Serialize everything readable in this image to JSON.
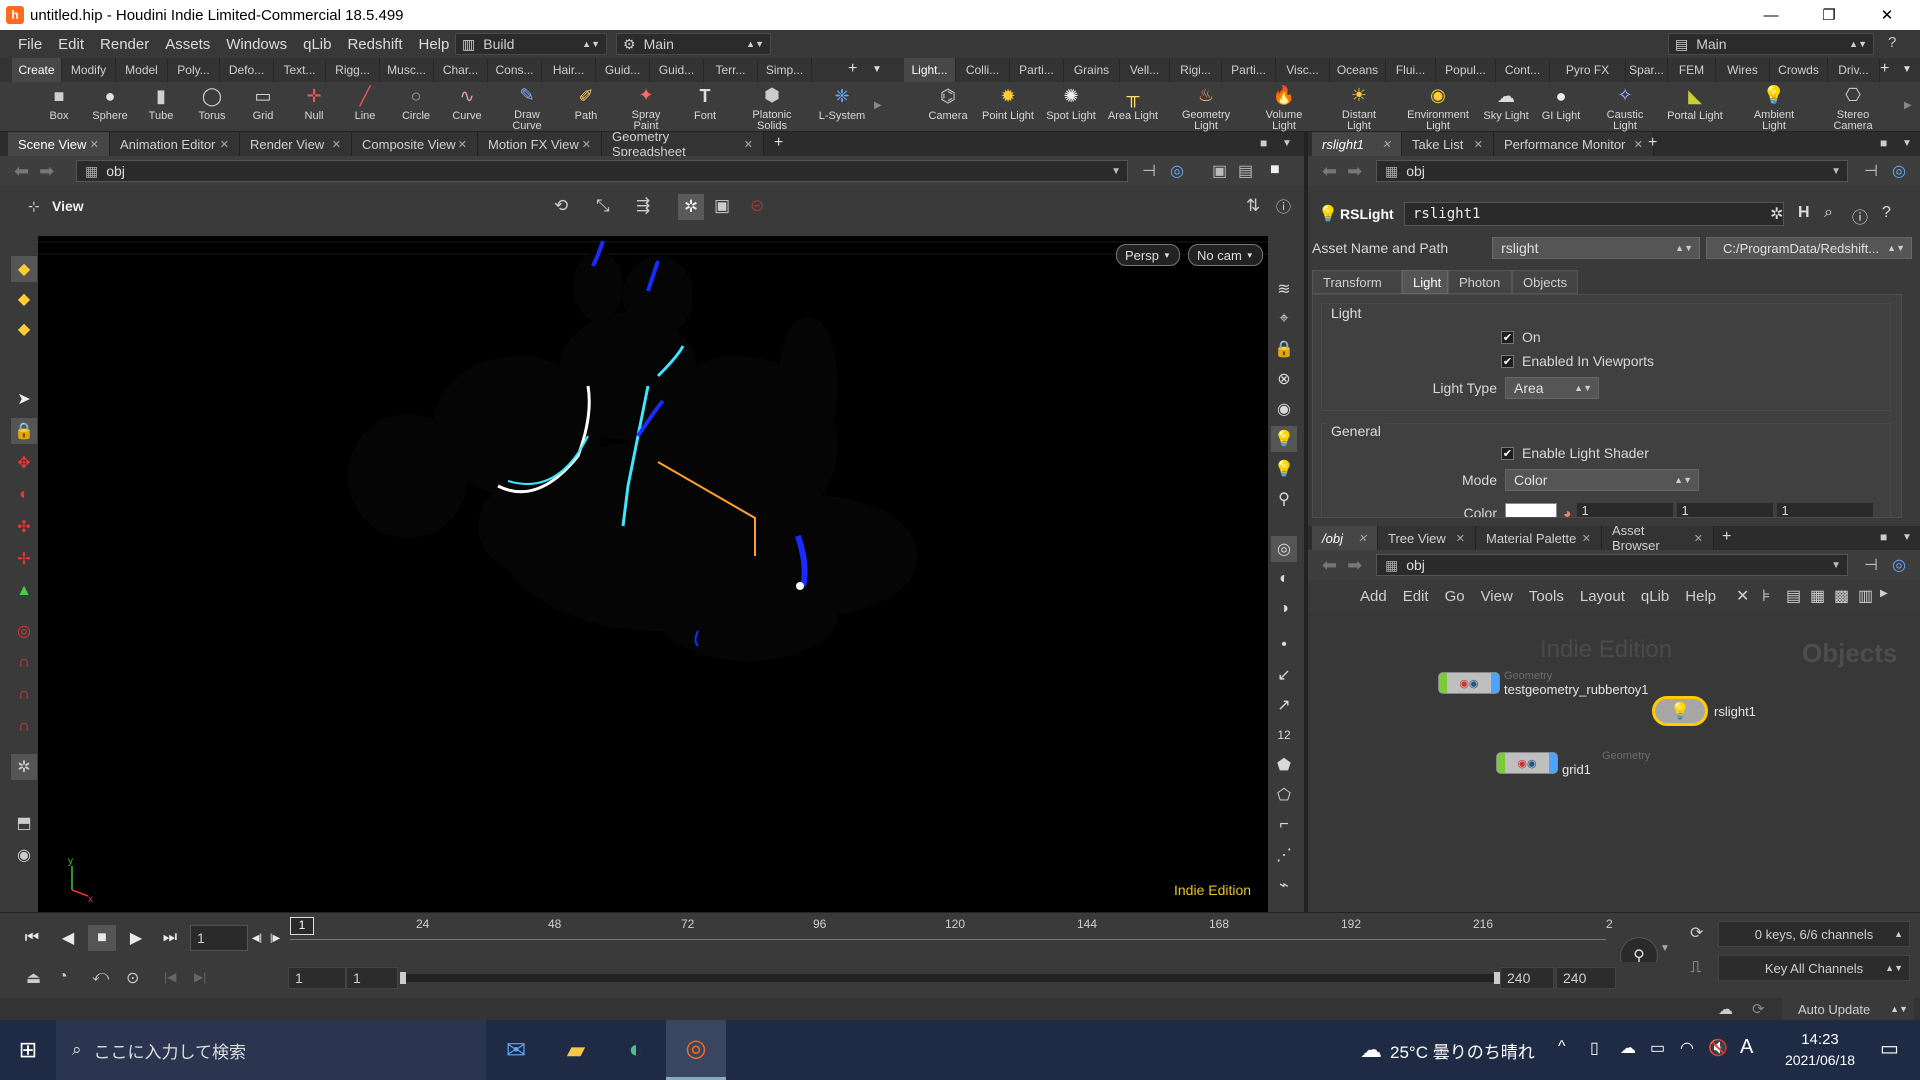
{
  "titlebar": {
    "title": "untitled.hip - Houdini Indie Limited-Commercial 18.5.499"
  },
  "menu": {
    "items": [
      "File",
      "Edit",
      "Render",
      "Assets",
      "Windows",
      "qLib",
      "Redshift",
      "Help"
    ],
    "desktop_left": "Build",
    "desktop_main": "Main",
    "desktop_right": "Main"
  },
  "shelf_tabs_left": [
    "Create",
    "Modify",
    "Model",
    "Poly...",
    "Defo...",
    "Text...",
    "Rigg...",
    "Musc...",
    "Char...",
    "Cons...",
    "Hair...",
    "Guid...",
    "Guid...",
    "Terr...",
    "Simp..."
  ],
  "shelf_tabs_right": [
    "Light...",
    "Colli...",
    "Parti...",
    "Grains",
    "Vell...",
    "Rigi...",
    "Parti...",
    "Visc...",
    "Oceans",
    "Flui...",
    "Popul...",
    "Cont...",
    "Pyro FX",
    "Spar...",
    "FEM",
    "Wires",
    "Crowds",
    "Driv..."
  ],
  "shelf_tools_left": [
    {
      "label": "Box",
      "icon": "box-icon"
    },
    {
      "label": "Sphere",
      "icon": "sphere-icon"
    },
    {
      "label": "Tube",
      "icon": "tube-icon"
    },
    {
      "label": "Torus",
      "icon": "torus-icon"
    },
    {
      "label": "Grid",
      "icon": "grid-icon"
    },
    {
      "label": "Null",
      "icon": "null-icon"
    },
    {
      "label": "Line",
      "icon": "line-icon"
    },
    {
      "label": "Circle",
      "icon": "circle-icon"
    },
    {
      "label": "Curve",
      "icon": "curve-icon"
    },
    {
      "label": "Draw Curve",
      "icon": "draw-curve-icon"
    },
    {
      "label": "Path",
      "icon": "path-icon"
    },
    {
      "label": "Spray Paint",
      "icon": "spray-paint-icon"
    },
    {
      "label": "Font",
      "icon": "font-icon"
    },
    {
      "label": "Platonic Solids",
      "icon": "platonic-icon"
    },
    {
      "label": "L-System",
      "icon": "lsystem-icon"
    }
  ],
  "shelf_tools_right": [
    {
      "label": "Camera",
      "icon": "camera-icon"
    },
    {
      "label": "Point Light",
      "icon": "point-light-icon"
    },
    {
      "label": "Spot Light",
      "icon": "spot-light-icon"
    },
    {
      "label": "Area Light",
      "icon": "area-light-icon"
    },
    {
      "label": "Geometry Light",
      "icon": "geometry-light-icon"
    },
    {
      "label": "Volume Light",
      "icon": "volume-light-icon"
    },
    {
      "label": "Distant Light",
      "icon": "distant-light-icon"
    },
    {
      "label": "Environment Light",
      "icon": "environment-light-icon"
    },
    {
      "label": "Sky Light",
      "icon": "sky-light-icon"
    },
    {
      "label": "GI Light",
      "icon": "gi-light-icon"
    },
    {
      "label": "Caustic Light",
      "icon": "caustic-light-icon"
    },
    {
      "label": "Portal Light",
      "icon": "portal-light-icon"
    },
    {
      "label": "Ambient Light",
      "icon": "ambient-light-icon"
    },
    {
      "label": "Stereo Camera",
      "icon": "stereo-camera-icon"
    }
  ],
  "left_panes": [
    "Scene View",
    "Animation Editor",
    "Render View",
    "Composite View",
    "Motion FX View",
    "Geometry Spreadsheet"
  ],
  "left_path": "obj",
  "viewer": {
    "label": "View",
    "persp": "Persp",
    "cam": "No cam",
    "watermark": "Indie Edition"
  },
  "param_panes": [
    "rslight1",
    "Take List",
    "Performance Monitor"
  ],
  "param_path": "obj",
  "node_header": {
    "type": "RSLight",
    "name": "rslight1"
  },
  "asset": {
    "label": "Asset Name and Path",
    "name": "rslight",
    "path": "C:/ProgramData/Redshift..."
  },
  "param_tabs": [
    "Transform",
    "Light",
    "Photon",
    "Objects"
  ],
  "light_section": {
    "title": "Light",
    "on": "On",
    "enabled_viewports": "Enabled In Viewports",
    "light_type_label": "Light Type",
    "light_type_value": "Area"
  },
  "general_section": {
    "title": "General",
    "enable_shader": "Enable Light Shader",
    "mode_label": "Mode",
    "mode_value": "Color",
    "color_label": "Color",
    "color_values": [
      "1",
      "1",
      "1"
    ]
  },
  "network_panes": [
    "/obj",
    "Tree View",
    "Material Palette",
    "Asset Browser"
  ],
  "network_path": "obj",
  "network_menu": [
    "Add",
    "Edit",
    "Go",
    "View",
    "Tools",
    "Layout",
    "qLib",
    "Help"
  ],
  "network": {
    "watermark": "Indie Edition",
    "context": "Objects",
    "nodes": [
      {
        "type": "Geometry",
        "name": "testgeometry_rubbertoy1"
      },
      {
        "type": "",
        "name": "rslight1"
      },
      {
        "type": "Geometry",
        "name": "grid1"
      }
    ]
  },
  "timeline": {
    "frame": "1",
    "ticks": [
      "24",
      "48",
      "72",
      "96",
      "120",
      "144",
      "168",
      "192",
      "216",
      "2"
    ],
    "current_marker": "1",
    "range_start": "1",
    "range_start2": "1",
    "range_end": "240",
    "range_end2": "240",
    "keys": "0 keys, 6/6 channels",
    "key_all": "Key All Channels",
    "auto_update": "Auto Update"
  },
  "taskbar": {
    "search": "ここに入力して検索",
    "weather": "25°C 曇りのち晴れ",
    "ime": "A",
    "time": "14:23",
    "date": "2021/06/18"
  },
  "colors": {
    "accent_orange": "#ff6a1f",
    "rim_cyan": "#40e6ff",
    "rim_blue": "#1a2bff",
    "selected_yellow": "#ffcc00"
  }
}
